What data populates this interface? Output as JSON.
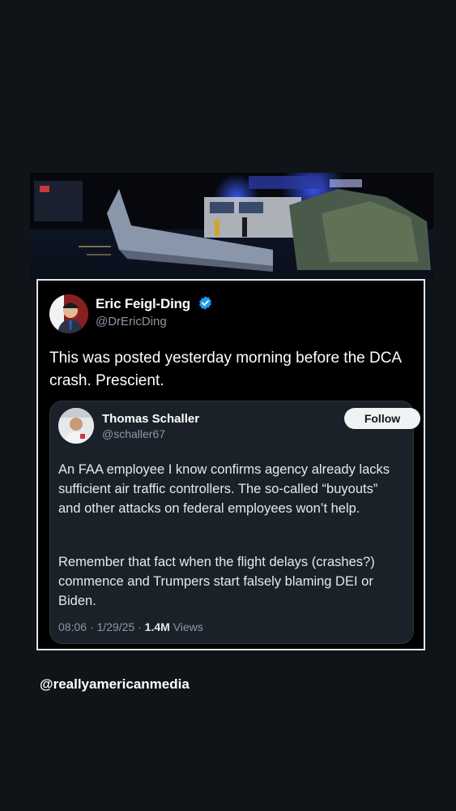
{
  "post": {
    "author_name": "Eric Feigl-Ding",
    "author_handle": "@DrEricDing",
    "text": "This was posted yesterday morning before the DCA crash. Prescient.",
    "verified_color": "#1d9bf0"
  },
  "quoted_post": {
    "author_name": "Thomas Schaller",
    "author_handle": "@schaller67",
    "follow_label": "Follow",
    "paragraph_1": "An FAA employee I know confirms agency already lacks sufficient air traffic controllers. The so-called “buyouts” and other attacks on federal employees won’t help.",
    "paragraph_2": "Remember that fact when the flight delays (crashes?) commence and Trumpers start falsely blaming DEI or Biden.",
    "time": "08:06",
    "date": "1/29/25",
    "views_count": "1.4M",
    "views_label": "Views"
  },
  "watermark": "@reallyamericanmedia",
  "icons": {
    "verified": "verified-badge-icon"
  },
  "colors": {
    "background": "#0f1419",
    "card": "#000000",
    "quote_card": "#1a2129",
    "muted_text": "#8b98a5",
    "verified": "#1d9bf0"
  }
}
